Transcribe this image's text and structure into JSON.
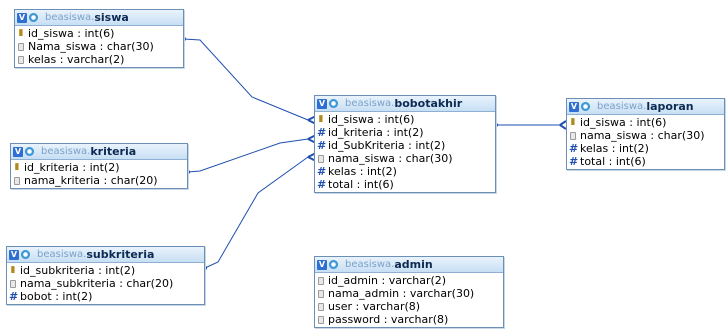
{
  "database": "beasiswa",
  "tables": {
    "siswa": {
      "db": "beasiswa",
      "name": "siswa",
      "fields": [
        {
          "icon": "key-icon",
          "text": "id_siswa : int(6)"
        },
        {
          "icon": "field-icon",
          "text": "Nama_siswa : char(30)"
        },
        {
          "icon": "field-icon",
          "text": "kelas : varchar(2)"
        }
      ]
    },
    "kriteria": {
      "db": "beasiswa",
      "name": "kriteria",
      "fields": [
        {
          "icon": "key-icon",
          "text": "id_kriteria : int(2)"
        },
        {
          "icon": "field-icon",
          "text": "nama_kriteria : char(20)"
        }
      ]
    },
    "subkriteria": {
      "db": "beasiswa",
      "name": "subkriteria",
      "fields": [
        {
          "icon": "key-icon",
          "text": "id_subkriteria : int(2)"
        },
        {
          "icon": "field-icon",
          "text": "nama_subkriteria : char(20)"
        },
        {
          "icon": "hash-icon",
          "text": "bobot : int(2)"
        }
      ]
    },
    "bobotakhir": {
      "db": "beasiswa",
      "name": "bobotakhir",
      "fields": [
        {
          "icon": "key-icon",
          "text": "id_siswa : int(6)"
        },
        {
          "icon": "hash-icon",
          "text": "id_kriteria : int(2)"
        },
        {
          "icon": "hash-icon",
          "text": "id_SubKriteria : int(2)"
        },
        {
          "icon": "field-icon",
          "text": "nama_siswa : char(30)"
        },
        {
          "icon": "hash-icon",
          "text": "kelas : int(2)"
        },
        {
          "icon": "hash-icon",
          "text": "total : int(6)"
        }
      ]
    },
    "laporan": {
      "db": "beasiswa",
      "name": "laporan",
      "fields": [
        {
          "icon": "key-icon",
          "text": "id_siswa : int(6)"
        },
        {
          "icon": "field-icon",
          "text": "nama_siswa : char(30)"
        },
        {
          "icon": "hash-icon",
          "text": "kelas : int(2)"
        },
        {
          "icon": "hash-icon",
          "text": "total : int(6)"
        }
      ]
    },
    "admin": {
      "db": "beasiswa",
      "name": "admin",
      "fields": [
        {
          "icon": "field-icon",
          "text": "id_admin : varchar(2)"
        },
        {
          "icon": "field-icon",
          "text": "nama_admin : varchar(30)"
        },
        {
          "icon": "field-icon",
          "text": "user : varchar(8)"
        },
        {
          "icon": "field-icon",
          "text": "password : varchar(8)"
        }
      ]
    }
  },
  "colors": {
    "link": "#1f4fb0",
    "header_bg": "#c7dff4",
    "border": "#6b8fb5",
    "db_prefix": "#7ca2c9"
  }
}
